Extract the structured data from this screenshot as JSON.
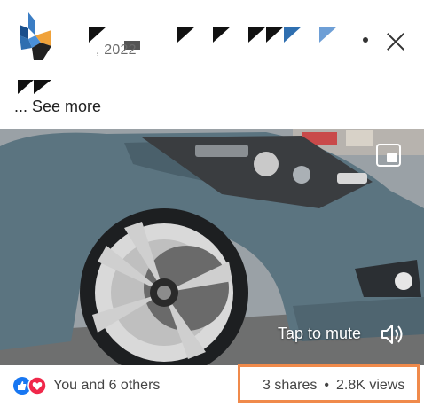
{
  "header": {
    "timestamp": ", 2022",
    "see_more": "... See more"
  },
  "icons": {
    "more": "more-icon",
    "close": "close-icon",
    "pip": "picture-in-picture-icon",
    "speaker": "speaker-icon",
    "like": "like-icon",
    "love": "love-icon"
  },
  "video": {
    "mute_label": "Tap to mute"
  },
  "footer": {
    "reactions_text": "You and 6 others",
    "shares": "3 shares",
    "views": "2.8K views",
    "separator": "•"
  },
  "colors": {
    "like_blue": "#1877f2",
    "love_red": "#f0284a",
    "highlight_orange": "#f08a4b"
  }
}
